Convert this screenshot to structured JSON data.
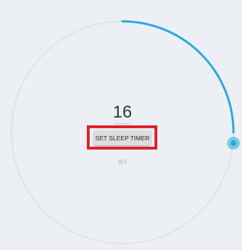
{
  "timer": {
    "value": "16",
    "dial_level": 0.25
  },
  "buttons": {
    "set_sleep_timer": "SET SLEEP TIMER"
  },
  "icons": {
    "volume": "speaker-icon",
    "handle": "dial-handle"
  },
  "colors": {
    "background": "#eceff3",
    "track": "#d9d9d9",
    "progress": "#29a8dc",
    "handle": "#29a8dc",
    "highlight": "#e0202a",
    "button_bg": "#dddddd"
  }
}
